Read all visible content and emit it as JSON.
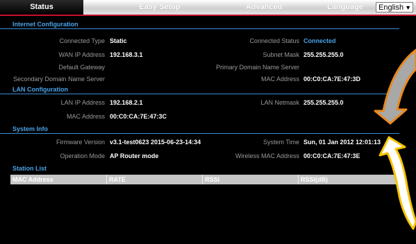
{
  "nav": {
    "tabs": [
      {
        "label": "Status",
        "active": true
      },
      {
        "label": "Easy Setup",
        "active": false
      },
      {
        "label": "Advanced",
        "active": false
      }
    ],
    "language_label": "Language",
    "language_value": "English"
  },
  "internet": {
    "title": "Internet Configuration",
    "connected_type_label": "Connected Type",
    "connected_type": "Static",
    "connected_status_label": "Connected Status",
    "connected_status": "Connected",
    "wan_ip_label": "WAN IP Address",
    "wan_ip": "192.168.3.1",
    "subnet_mask_label": "Subnet Mask",
    "subnet_mask": "255.255.255.0",
    "default_gateway_label": "Default Gateway",
    "primary_dns_label": "Primary Domain Name Server",
    "secondary_dns_label": "Secondary Domain Name Server",
    "mac_label": "MAC Address",
    "mac": "00:C0:CA:7E:47:3D"
  },
  "lan": {
    "title": "LAN Configuration",
    "lan_ip_label": "LAN IP Address",
    "lan_ip": "192.168.2.1",
    "lan_netmask_label": "LAN Netmask",
    "lan_netmask": "255.255.255.0",
    "mac_label": "MAC Address",
    "mac": "00:C0:CA:7E:47:3C"
  },
  "system": {
    "title": "System Info",
    "firmware_label": "Firmware Version",
    "firmware": "v3.1-test0623  2015-06-23-14:34",
    "system_time_label": "System Time",
    "system_time": "Sun, 01 Jan 2012 12:01:13",
    "operation_mode_label": "Operation Mode",
    "operation_mode": "AP Router mode",
    "wireless_mac_label": "Wireless MAC Address",
    "wireless_mac": "00:C0:CA:7E:47:3E"
  },
  "station": {
    "title": "Station List",
    "columns": [
      "MAC Address",
      "RATE",
      "RSSI",
      "RSSI(dB)"
    ]
  },
  "colors": {
    "accent": "#4aa3e8",
    "nav_red": "#c8102e",
    "arrow_orange": "#e8891e",
    "arrow_yellow": "#f5c400"
  }
}
